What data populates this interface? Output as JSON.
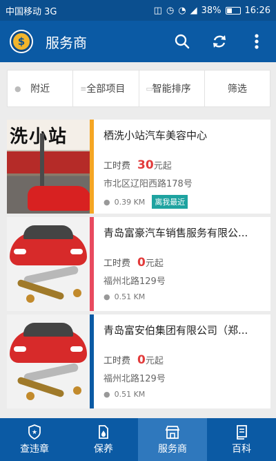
{
  "status_bar": {
    "carrier": "中国移动 3G",
    "network": "3G",
    "battery": "38%",
    "battery_level": 0.38,
    "time": "16:26"
  },
  "app_bar": {
    "title": "服务商",
    "icons": [
      "dollar-coin-icon",
      "search-icon",
      "refresh-icon",
      "more-vert-icon"
    ]
  },
  "filters": [
    {
      "label": "附近",
      "icon": "location-pin-icon"
    },
    {
      "label": "全部项目",
      "icon": "list-icon"
    },
    {
      "label": "智能排序",
      "icon": "image-icon"
    },
    {
      "label": "筛选",
      "icon": ""
    }
  ],
  "providers": [
    {
      "name": "栖洗小站汽车美容中心",
      "price_label": "工时费",
      "price": "30",
      "price_unit": "元起",
      "address": "市北区辽阳西路178号",
      "distance": "0.39 KM",
      "badge": "离我最近",
      "sign_text": "洗小站",
      "stripe_color": "#f5a623"
    },
    {
      "name": "青岛富豪汽车销售服务有限公...",
      "price_label": "工时费",
      "price": "0",
      "price_unit": "元起",
      "address": "福州北路129号",
      "distance": "0.51 KM",
      "badge": "",
      "stripe_color": "#e84a5f"
    },
    {
      "name": "青岛富安伯集团有限公司（郑...",
      "price_label": "工时费",
      "price": "0",
      "price_unit": "元起",
      "address": "福州北路129号",
      "distance": "0.51 KM",
      "badge": "",
      "stripe_color": "#0b5aa4"
    }
  ],
  "bottom_nav": [
    {
      "label": "查违章",
      "icon": "shield-star-icon",
      "active": false
    },
    {
      "label": "保养",
      "icon": "oil-drop-icon",
      "active": false
    },
    {
      "label": "服务商",
      "icon": "store-icon",
      "active": true
    },
    {
      "label": "百科",
      "icon": "book-icon",
      "active": false
    }
  ],
  "colors": {
    "primary": "#0b5aa4",
    "status_bar": "#0b4f8f",
    "accent_price": "#e23b3b",
    "badge": "#1ea3a0"
  }
}
